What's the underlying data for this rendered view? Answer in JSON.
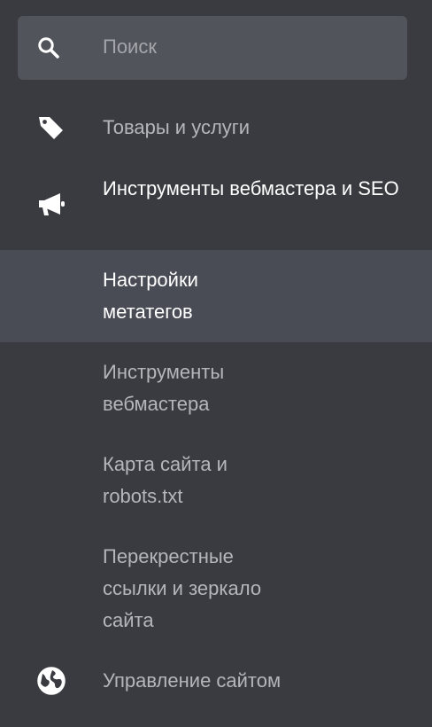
{
  "search": {
    "placeholder": "Поиск"
  },
  "nav": {
    "products": {
      "label": "Товары и услуги",
      "icon": "tag-icon"
    },
    "webmaster_seo": {
      "label": "Инструменты вебмастера и SEO",
      "icon": "megaphone-icon",
      "active": true
    },
    "site_management": {
      "label": "Управление сайтом",
      "icon": "globe-icon"
    }
  },
  "subnav": {
    "items": [
      {
        "label": "Настройки метатегов",
        "current": true
      },
      {
        "label": "Инструменты вебмастера"
      },
      {
        "label": "Карта сайта и robots.txt"
      },
      {
        "label": "Перекрестные ссылки и зеркало сайта"
      }
    ]
  },
  "colors": {
    "background": "#3a3b40",
    "search_bg": "#52545b",
    "current_item_bg": "#4a4c55",
    "text_muted": "#b5b6ba",
    "text_active": "#ffffff"
  }
}
